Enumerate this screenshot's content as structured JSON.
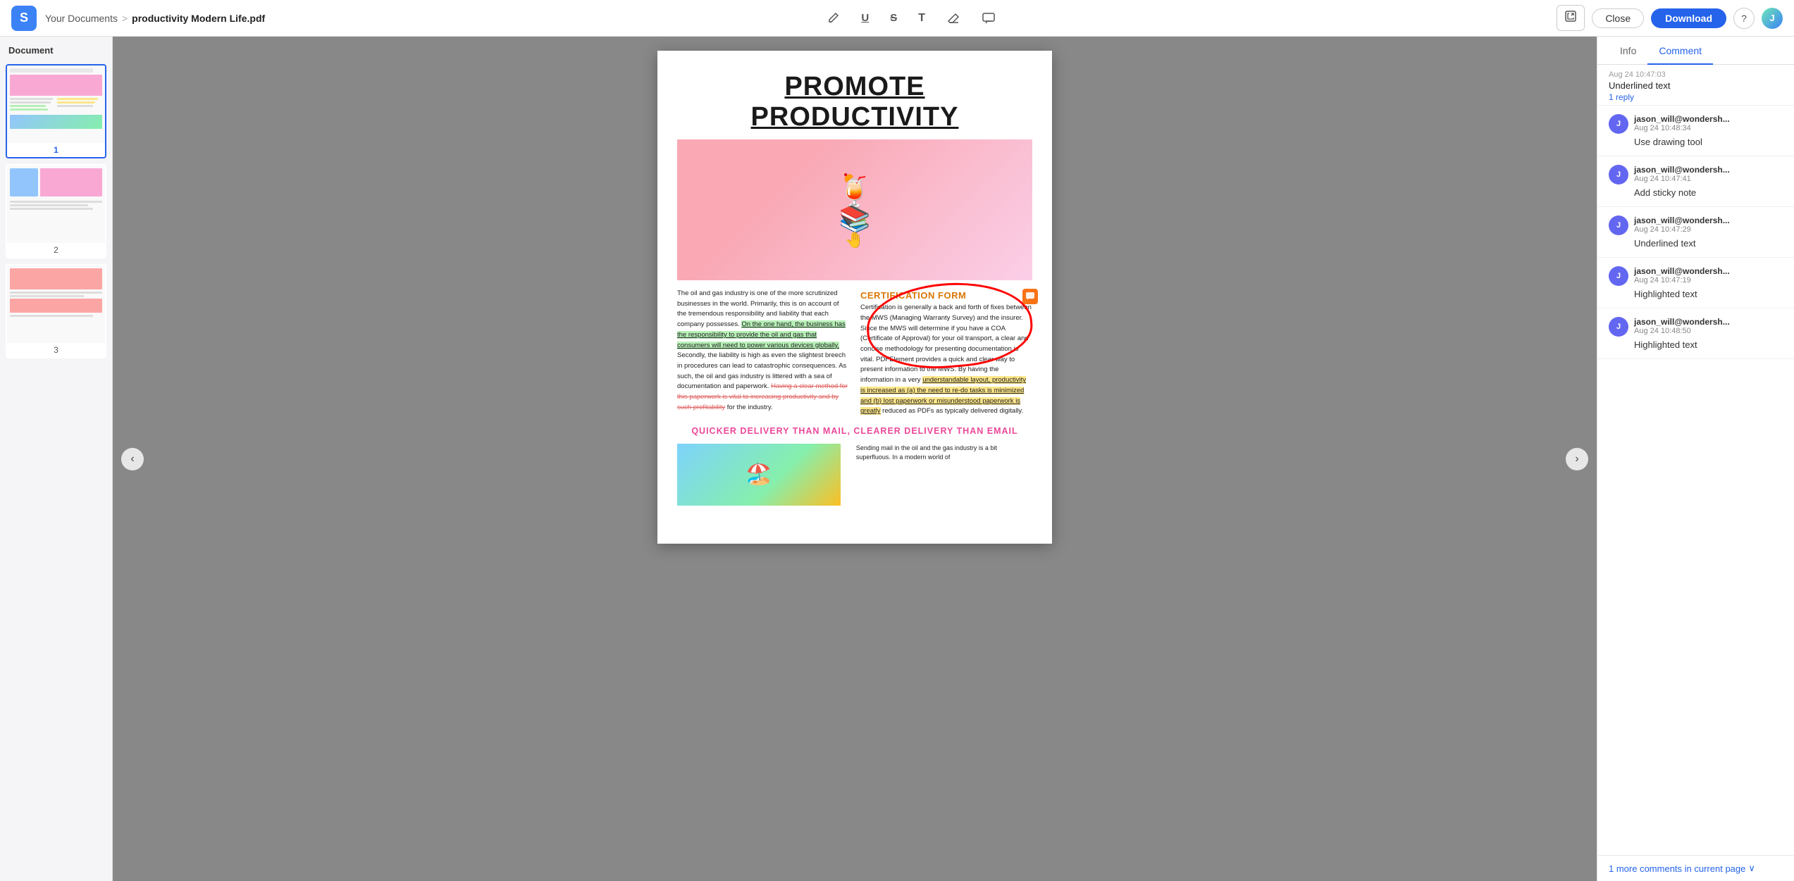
{
  "app": {
    "logo_letter": "S",
    "breadcrumb_parent": "Your Documents",
    "breadcrumb_sep": ">",
    "breadcrumb_current": "productivity Modern Life.pdf"
  },
  "toolbar": {
    "tools": [
      {
        "name": "highlight-tool",
        "icon": "✏️"
      },
      {
        "name": "underline-tool",
        "icon": "U̲"
      },
      {
        "name": "strikethrough-tool",
        "icon": "S̶"
      },
      {
        "name": "text-tool",
        "icon": "T"
      },
      {
        "name": "eraser-tool",
        "icon": "◻"
      },
      {
        "name": "comment-tool",
        "icon": "💬"
      }
    ],
    "open_label": "⬚",
    "close_label": "Close",
    "download_label": "Download",
    "help_label": "?"
  },
  "sidebar": {
    "title": "Document",
    "pages": [
      {
        "num": "1",
        "active": true
      },
      {
        "num": "2",
        "active": false
      },
      {
        "num": "3",
        "active": false
      }
    ]
  },
  "pdf": {
    "title": "PROMOTE PRODUCTIVITY",
    "col1_text1": "The oil and gas industry is one of the more scrutinized businesses in the world. Primarily, this is on account of the tremendous responsibility and liability that each company possesses.",
    "col1_highlight": "On the one hand, the business has the responsibility to provide the oil and gas that consumers will need to power various devices globally.",
    "col1_text2": "Secondly, the liability is high as even the slightest breech in procedures can lead to catastrophic consequences. As such, the oil and gas industry is littered with a sea of documentation and paperwork.",
    "col1_strikethrough": "Having a clear method for this paperwork is vital to increasing productivity and by such profitability",
    "col1_text3": "for the industry.",
    "col2_cert": "CERTIFICATION FORM",
    "col2_text1": "Certification is generally a back and forth of fixes between the MWS (Managing Warranty Survey) and the insurer. Since the MWS will determine if you have a COA (Certificate of Approval) for your oil transport, a clear and concise methodology for presenting documentation is vital. PDFElement provides a quick and clear way to present information to the MWS. By having the information in a very",
    "col2_highlight": "understandable layout, productivity is increased as (a) the need to re-do tasks is minimized and (b) lost paperwork or misunderstood paperwork is greatly",
    "col2_text2": "reduced as PDFs as typically delivered digitally.",
    "subheading": "QUICKER DELIVERY THAN MAIL, CLEARER DELIVERY THAN EMAIL",
    "lower_text": "Sending mail in the oil and the gas industry is a bit superfluous. In a modern world of"
  },
  "right_panel": {
    "tabs": [
      {
        "label": "Info",
        "active": false
      },
      {
        "label": "Comment",
        "active": true
      }
    ],
    "top_comment": {
      "date": "Aug 24 10:47:03",
      "text": "Underlined text",
      "reply": "1 reply"
    },
    "comments": [
      {
        "user": "jason_will@wondersh...",
        "time": "Aug 24 10:48:34",
        "text": "Use drawing tool",
        "has_reply": false
      },
      {
        "user": "jason_will@wondersh...",
        "time": "Aug 24 10:47:41",
        "text": "Add sticky note",
        "has_reply": false
      },
      {
        "user": "jason_will@wondersh...",
        "time": "Aug 24 10:47:29",
        "text": "Underlined text",
        "has_reply": false
      },
      {
        "user": "jason_will@wondersh...",
        "time": "Aug 24 10:47:19",
        "text": "Highlighted text",
        "has_reply": false
      },
      {
        "user": "jason_will@wondersh...",
        "time": "Aug 24 10:48:50",
        "text": "Highlighted text",
        "has_reply": false
      }
    ],
    "more_comments_label": "1 more comments in current page",
    "more_icon": "∨"
  }
}
